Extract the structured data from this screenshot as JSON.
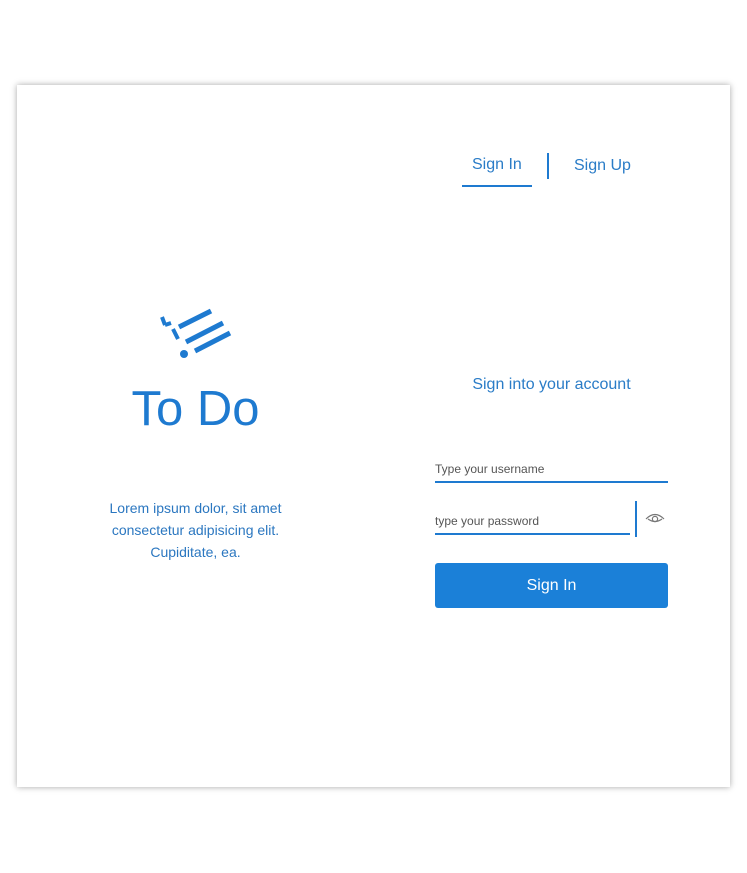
{
  "brand": {
    "app_name": "To Do",
    "tagline": "Lorem ipsum dolor, sit amet consectetur adipisicing elit. Cupiditate, ea.",
    "icon": "checklist-icon",
    "accent_color": "#1e7ad0"
  },
  "tabs": [
    {
      "label": "Sign In",
      "active": true
    },
    {
      "label": "Sign Up",
      "active": false
    }
  ],
  "form": {
    "heading": "Sign into your account",
    "username_placeholder": "Type your username",
    "password_placeholder": "type your password",
    "password_toggle_icon": "eye-icon",
    "submit_label": "Sign In"
  }
}
